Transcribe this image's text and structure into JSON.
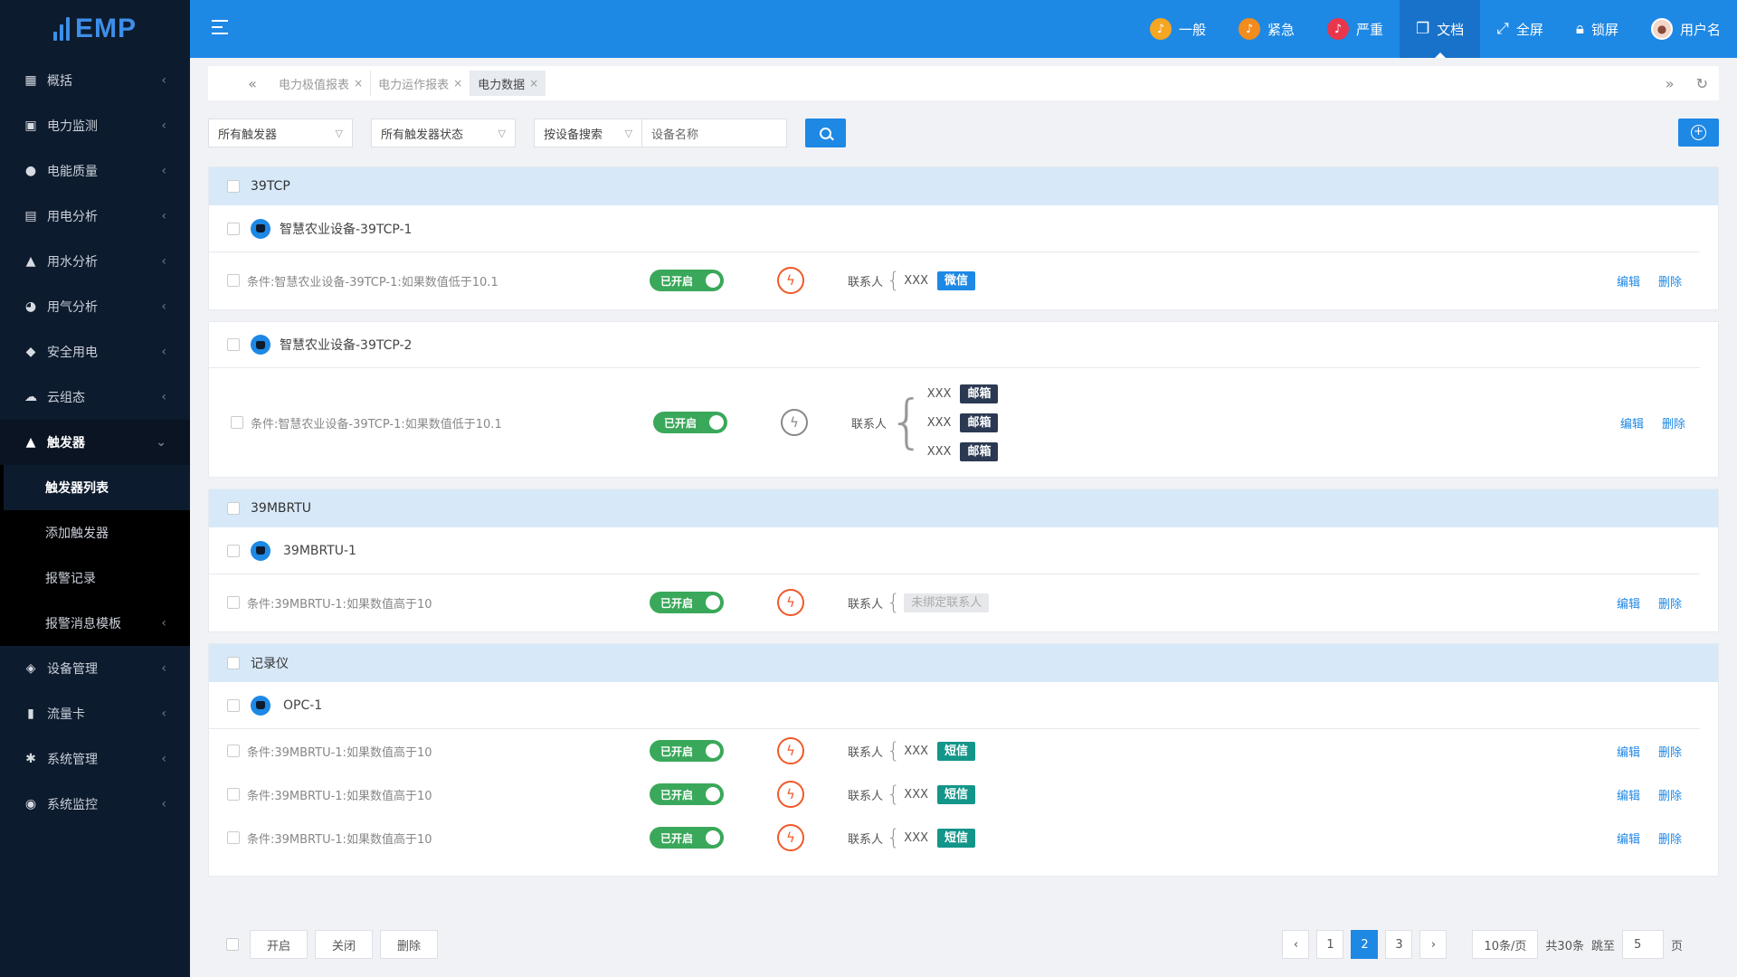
{
  "app": {
    "logo_text": "EMP"
  },
  "sidebar": {
    "items": [
      {
        "label": "概括",
        "icon": "dashboard-icon",
        "glyph": "▦"
      },
      {
        "label": "电力监测",
        "icon": "monitor-icon",
        "glyph": "▣"
      },
      {
        "label": "电能质量",
        "icon": "bulb-icon",
        "glyph": "●"
      },
      {
        "label": "用电分析",
        "icon": "chart-icon",
        "glyph": "▤"
      },
      {
        "label": "用水分析",
        "icon": "water-drop-icon",
        "glyph": "▲"
      },
      {
        "label": "用气分析",
        "icon": "gas-icon",
        "glyph": "◕"
      },
      {
        "label": "安全用电",
        "icon": "shield-icon",
        "glyph": "◆"
      },
      {
        "label": "云组态",
        "icon": "cloud-icon",
        "glyph": "☁"
      },
      {
        "label": "触发器",
        "icon": "bell-icon",
        "glyph": "▲"
      }
    ],
    "trigger_sub": [
      {
        "label": "触发器列表"
      },
      {
        "label": "添加触发器"
      },
      {
        "label": "报警记录"
      },
      {
        "label": "报警消息模板"
      }
    ],
    "items_after": [
      {
        "label": "设备管理",
        "icon": "cube-icon",
        "glyph": "◈"
      },
      {
        "label": "流量卡",
        "icon": "sim-card-icon",
        "glyph": "▮"
      },
      {
        "label": "系统管理",
        "icon": "gear-icon",
        "glyph": "✱"
      },
      {
        "label": "系统监控",
        "icon": "monitor-eye-icon",
        "glyph": "◉"
      }
    ]
  },
  "header": {
    "alerts": [
      {
        "label": "一般",
        "color": "#f5a623"
      },
      {
        "label": "紧急",
        "color": "#f28c1c"
      },
      {
        "label": "严重",
        "color": "#e8374c"
      }
    ],
    "doc_label": "文档",
    "fullscreen_label": "全屏",
    "lock_label": "锁屏",
    "user_label": "用户名"
  },
  "tabs": [
    {
      "label": "电力极值报表"
    },
    {
      "label": "电力运作报表"
    },
    {
      "label": "电力数据"
    }
  ],
  "filters": {
    "trigger": "所有触发器",
    "trigger_state": "所有触发器状态",
    "search_by": "按设备搜索",
    "device_placeholder": "设备名称"
  },
  "common": {
    "enabled": "已开启",
    "contact": "联系人",
    "edit": "编辑",
    "delete": "删除",
    "xxx": "XXX",
    "wechat": "微信",
    "email": "邮箱",
    "sms": "短信",
    "unbound": "未绑定联系人"
  },
  "groups": {
    "g1_name": "39TCP",
    "g1_dev1": "智慧农业设备-39TCP-1",
    "g1_dev1_cond": "条件:智慧农业设备-39TCP-1:如果数值低于10.1",
    "g1_dev2": "智慧农业设备-39TCP-2",
    "g1_dev2_cond": "条件:智慧农业设备-39TCP-1:如果数值低于10.1",
    "g2_name": "39MBRTU",
    "g2_dev1": "39MBRTU-1",
    "g2_dev1_cond": "条件:39MBRTU-1:如果数值高于10",
    "g3_name": "记录仪",
    "g3_dev1": "OPC-1",
    "g3_cond1": "条件:39MBRTU-1:如果数值高于10",
    "g3_cond2": "条件:39MBRTU-1:如果数值高于10",
    "g3_cond3": "条件:39MBRTU-1:如果数值高于10"
  },
  "footer": {
    "open": "开启",
    "close": "关闭",
    "delete": "删除",
    "pages": [
      "1",
      "2",
      "3"
    ],
    "page_size": "10条/页",
    "total": "共30条",
    "jump": "跳至",
    "jump_value": "5",
    "page_unit": "页"
  }
}
